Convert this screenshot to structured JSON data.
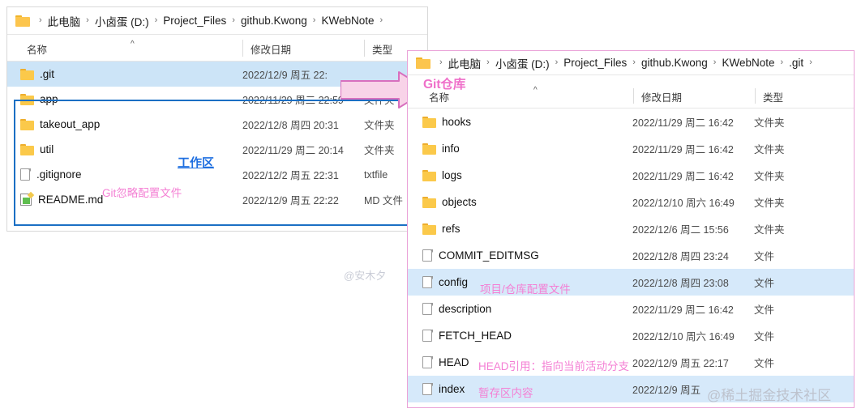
{
  "left_window": {
    "breadcrumb": {
      "folder_icon": "folder-icon",
      "separator": "›",
      "items": [
        "此电脑",
        "小卤蛋 (D:)",
        "Project_Files",
        "github.Kwong",
        "KWebNote"
      ],
      "trailing_separator": "›"
    },
    "columns": {
      "name": "名称",
      "modified": "修改日期",
      "type": "类型"
    },
    "rows": [
      {
        "icon": "folder-icon",
        "name": ".git",
        "modified": "2022/12/9 周五 22:",
        "type": "",
        "selected": true
      },
      {
        "icon": "folder-icon",
        "name": "app",
        "modified": "2022/11/29 周二 22:59",
        "type": "文件夹",
        "selected": false
      },
      {
        "icon": "folder-icon",
        "name": "takeout_app",
        "modified": "2022/12/8 周四 20:31",
        "type": "文件夹",
        "selected": false
      },
      {
        "icon": "folder-icon",
        "name": "util",
        "modified": "2022/11/29 周二 20:14",
        "type": "文件夹",
        "selected": false
      },
      {
        "icon": "file-icon",
        "name": ".gitignore",
        "modified": "2022/12/2 周五 22:31",
        "type": "txtfile",
        "selected": false
      },
      {
        "icon": "markdown-icon",
        "name": "README.md",
        "modified": "2022/12/9 周五 22:22",
        "type": "MD 文件",
        "selected": false
      }
    ],
    "annotations": {
      "workspace": "工作区",
      "gitignore": "Git忽略配置文件"
    }
  },
  "right_window": {
    "breadcrumb": {
      "folder_icon": "folder-icon",
      "separator": "›",
      "items": [
        "此电脑",
        "小卤蛋 (D:)",
        "Project_Files",
        "github.Kwong",
        "KWebNote",
        ".git"
      ],
      "trailing_separator": "›"
    },
    "columns": {
      "name": "名称",
      "modified": "修改日期",
      "type": "类型"
    },
    "rows": [
      {
        "icon": "folder-icon",
        "name": "hooks",
        "modified": "2022/11/29 周二 16:42",
        "type": "文件夹",
        "selected": false
      },
      {
        "icon": "folder-icon",
        "name": "info",
        "modified": "2022/11/29 周二 16:42",
        "type": "文件夹",
        "selected": false
      },
      {
        "icon": "folder-icon",
        "name": "logs",
        "modified": "2022/11/29 周二 16:42",
        "type": "文件夹",
        "selected": false
      },
      {
        "icon": "folder-icon",
        "name": "objects",
        "modified": "2022/12/10 周六 16:49",
        "type": "文件夹",
        "selected": false
      },
      {
        "icon": "folder-icon",
        "name": "refs",
        "modified": "2022/12/6 周二 15:56",
        "type": "文件夹",
        "selected": false
      },
      {
        "icon": "file-icon",
        "name": "COMMIT_EDITMSG",
        "modified": "2022/12/8 周四 23:24",
        "type": "文件",
        "selected": false
      },
      {
        "icon": "file-icon",
        "name": "config",
        "modified": "2022/12/8 周四 23:08",
        "type": "文件",
        "selected": true
      },
      {
        "icon": "file-icon",
        "name": "description",
        "modified": "2022/11/29 周二 16:42",
        "type": "文件",
        "selected": false
      },
      {
        "icon": "file-icon",
        "name": "FETCH_HEAD",
        "modified": "2022/12/10 周六 16:49",
        "type": "文件",
        "selected": false
      },
      {
        "icon": "file-icon",
        "name": "HEAD",
        "modified": "2022/12/9 周五 22:17",
        "type": "文件",
        "selected": false
      },
      {
        "icon": "file-icon",
        "name": "index",
        "modified": "2022/12/9 周五",
        "type": "",
        "selected": true
      }
    ],
    "annotations": {
      "repo_title": "Git仓库",
      "config": "项目/仓库配置文件",
      "head": "HEAD引用：指向当前活动分支",
      "index": "暂存区内容"
    }
  },
  "watermarks": {
    "center": "@安木夕",
    "bottom_right": "@稀土掘金技术社区"
  },
  "colors": {
    "selection_blue": "#cce4f7",
    "annotation_pink": "#f47fd4",
    "annotation_blue": "#1f6fe0",
    "box_blue": "#1b6fc4",
    "box_pink": "#eaa3d8",
    "folder_yellow": "#fbc94a",
    "arrow_fill": "#f8d3e8",
    "arrow_stroke": "#d86fbe"
  }
}
